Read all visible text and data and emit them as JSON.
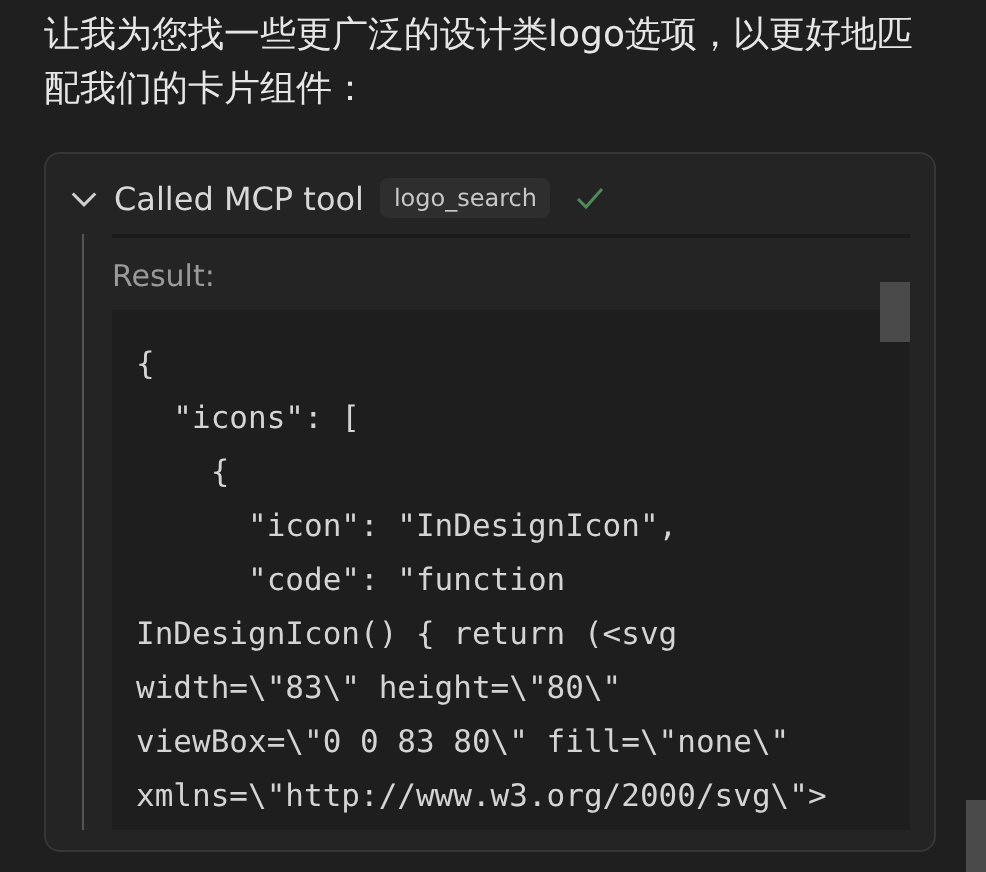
{
  "message": "让我为您找一些更广泛的设计类logo选项，以更好地匹配我们的卡片组件：",
  "tool_call": {
    "expanded": true,
    "label": "Called MCP tool",
    "tool_name": "logo_search",
    "succeeded": true,
    "result_label": "Result:",
    "code_lines": [
      "{",
      "  \"icons\": [",
      "    {",
      "      \"icon\": \"InDesignIcon\",",
      "      \"code\": \"function",
      "InDesignIcon() { return (<svg",
      "width=\\\"83\\\" height=\\\"80\\\"",
      "viewBox=\\\"0 0 83 80\\\" fill=\\\"none\\\"",
      "xmlns=\\\"http://www.w3.org/2000/svg\\\">"
    ]
  }
}
